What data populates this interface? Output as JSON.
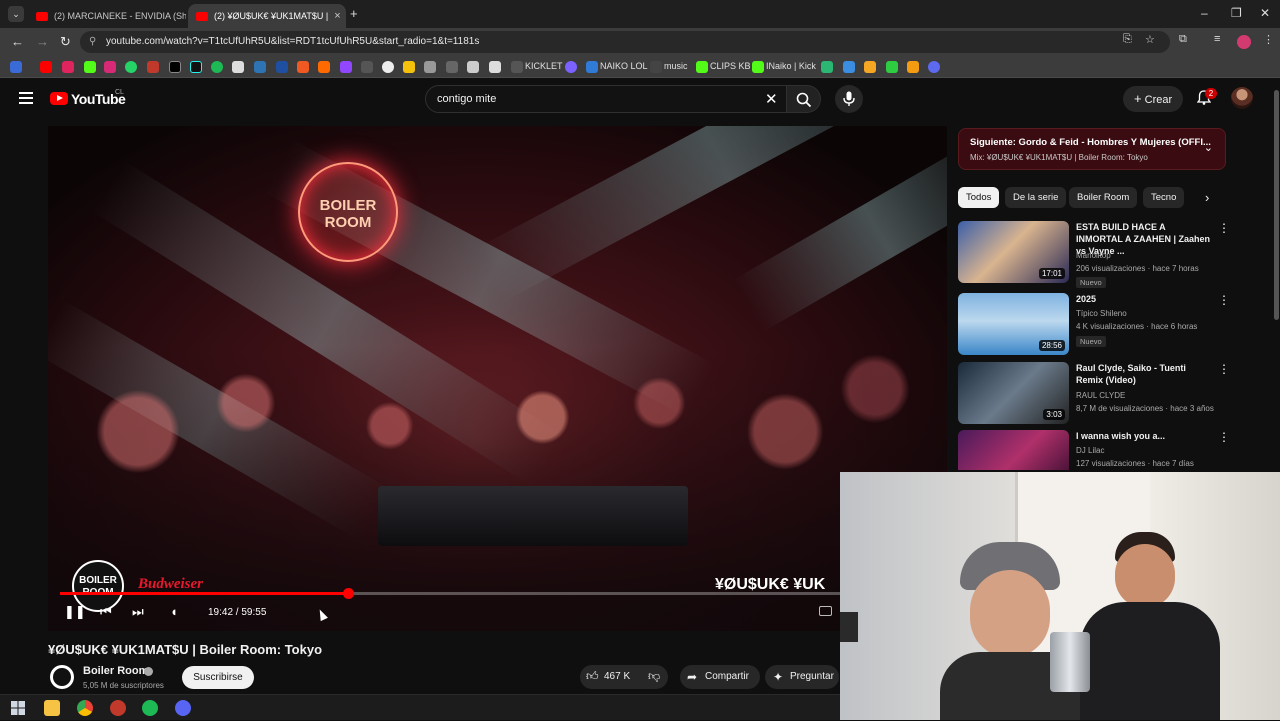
{
  "browser": {
    "tabs": [
      {
        "label": "(2) MARCIANEKE - ENVIDIA (Sh",
        "active": false
      },
      {
        "label": "(2) ¥ØU$UK€ ¥UK1MAT$U |",
        "active": true
      }
    ],
    "url": "youtube.com/watch?v=T1tcUfUhR5U&list=RDT1tcUfUhR5U&start_radio=1&t=1181s",
    "bookmarks": [
      "KICKLET",
      "NAIKO LOL",
      "music",
      "CLIPS KB",
      "INaiko | Kick"
    ]
  },
  "youtube": {
    "logo": "YouTube",
    "country_code": "CL",
    "search_query": "contigo mite",
    "create_label": "Crear",
    "notifications": "2",
    "player": {
      "watermark_logo": "BOILER ROOM",
      "sponsor": "Budweiser",
      "watermark_text": "¥ØU$UK€ ¥UK",
      "time": "19:42 / 59:55",
      "progress": 0.329
    },
    "video": {
      "title": "¥ØU$UK€ ¥UK1MAT$U | Boiler Room: Tokyo",
      "channel": "Boiler Room",
      "subscribers": "5,05 M de suscriptores",
      "subscribe_label": "Suscribirse",
      "likes": "467 K",
      "share_label": "Compartir",
      "ask_label": "Preguntar"
    },
    "up_next": {
      "title": "Siguiente: Gordo & Feid - Hombres Y Mujeres (OFFI...",
      "subtitle": "Mix: ¥ØU$UK€ ¥UK1MAT$U | Boiler Room: Tokyo"
    },
    "chips": [
      "Todos",
      "De la serie",
      "Boiler Room",
      "Tecno"
    ],
    "recommendations": [
      {
        "title": "ESTA BUILD HACE A INMORTAL A ZAAHEN | Zaahen vs Vayne ...",
        "channel": "Manolitop",
        "meta": "206 visualizaciones · hace 7 horas",
        "badge": "Nuevo",
        "duration": "17:01"
      },
      {
        "title": "2025",
        "channel": "Típico Shileno",
        "meta": "4 K visualizaciones · hace 6 horas",
        "badge": "Nuevo",
        "duration": "28:56"
      },
      {
        "title": "Raul Clyde, Saiko - Tuenti Remix (Video)",
        "channel": "RAUL CLYDE",
        "meta": "8,7 M de visualizaciones · hace 3 años",
        "badge": "",
        "duration": "3:03"
      },
      {
        "title": "I wanna wish you a...",
        "channel": "DJ Lilac",
        "meta": "127 visualizaciones · hace 7 días",
        "badge": "",
        "duration": ""
      }
    ]
  },
  "colors": {
    "brand_red": "#ff0000",
    "background": "#0f0f0f",
    "up_next_bg": "#3a0b10"
  }
}
